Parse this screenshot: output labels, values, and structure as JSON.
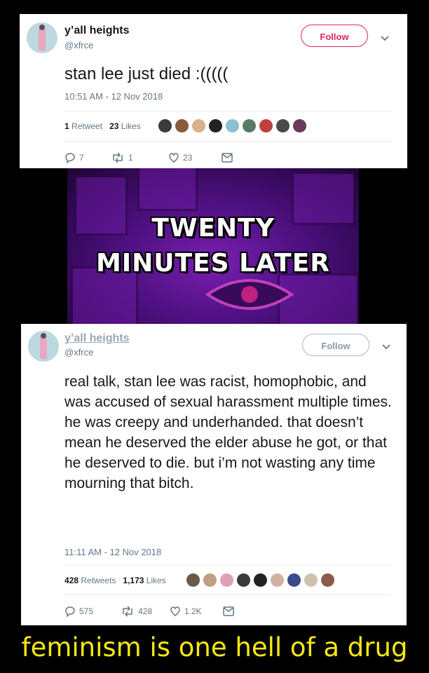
{
  "tweet1": {
    "display_name": "y’all heights",
    "handle": "@xfrce",
    "follow_label": "Follow",
    "text": "stan lee just died :(((((",
    "timestamp": "10:51 AM - 12 Nov 2018",
    "retweets_count": "1",
    "retweets_label": "Retweet",
    "likes_count": "23",
    "likes_label": "Likes",
    "reply_count": "7",
    "retweet_action_count": "1",
    "like_action_count": "23",
    "liker_colors": [
      "#3a3a3a",
      "#8a5a3a",
      "#d8b08a",
      "#222",
      "#8ac0d0",
      "#5a7a6a",
      "#c04040",
      "#4a4a4a",
      "#6a3a5a"
    ]
  },
  "interstitial": {
    "line1": "TWENTY",
    "line2": "MINUTES LATER"
  },
  "tweet2": {
    "display_name": "y’all heights",
    "handle": "@xfrce",
    "follow_label": "Follow",
    "text": "real talk, stan lee was racist, homophobic, and was accused of sexual harassment multiple times. he was creepy and underhanded. that doesn’t mean he deserved the elder abuse he got, or that he deserved to die. but i’m not wasting any time mourning that bitch.",
    "timestamp": "11:11 AM - 12 Nov 2018",
    "retweets_count": "428",
    "retweets_label": "Retweets",
    "likes_count": "1,173",
    "likes_label": "Likes",
    "reply_count": "575",
    "retweet_action_count": "428",
    "like_action_count": "1.2K",
    "liker_colors": [
      "#6a5a4a",
      "#c0a080",
      "#e0a0b0",
      "#3a3a3a",
      "#222",
      "#d0b0a0",
      "#3a4a8a",
      "#d0c0b0",
      "#8a5a4a"
    ]
  },
  "caption": "feminism is one hell of a drug"
}
